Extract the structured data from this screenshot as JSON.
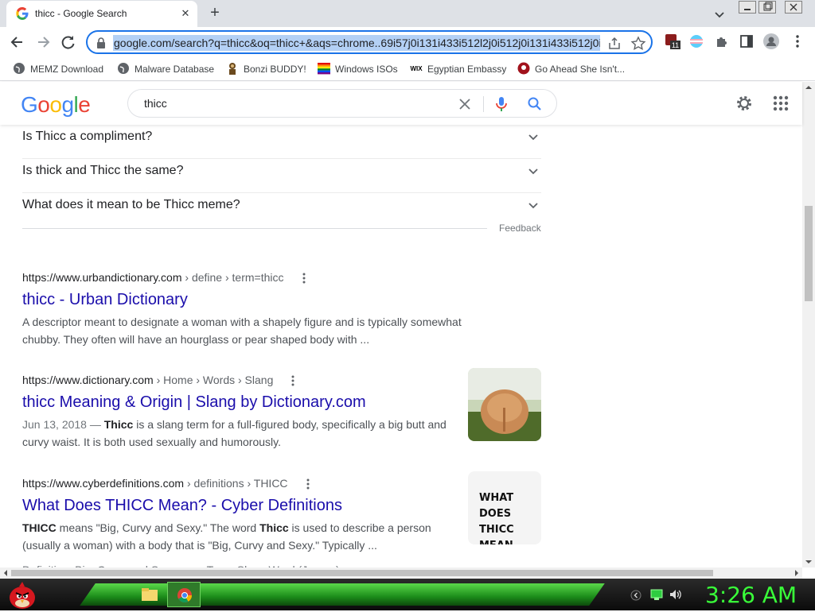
{
  "browser": {
    "tab_title": "thicc - Google Search",
    "url": "google.com/search?q=thicc&oq=thicc+&aqs=chrome..69i57j0i131i433i512l2j0i512j0i131i433i512j0i512",
    "extension_badge": "11",
    "bookmarks": [
      {
        "label": "MEMZ Download",
        "icon": "globe-icon"
      },
      {
        "label": "Malware Database",
        "icon": "globe-icon"
      },
      {
        "label": "Bonzi BUDDY!",
        "icon": "bonzi-icon"
      },
      {
        "label": "Windows ISOs",
        "icon": "rainbow-flag-icon"
      },
      {
        "label": "Egyptian Embassy",
        "icon": "wix-icon"
      },
      {
        "label": "Go Ahead She Isn't...",
        "icon": "red-circle-icon"
      }
    ]
  },
  "google": {
    "logo": "Google",
    "query": "thicc",
    "paa_questions": [
      "Is Thicc a compliment?",
      "Is thick and Thicc the same?",
      "What does it mean to be Thicc meme?"
    ],
    "feedback": "Feedback",
    "results": [
      {
        "domain": "https://www.urbandictionary.com",
        "path": " › define › term=thicc",
        "title": "thicc - Urban Dictionary",
        "snippet": "A descriptor meant to designate a woman with a shapely figure and is typically somewhat chubby. They often will have an hourglass or pear shaped body with ..."
      },
      {
        "domain": "https://www.dictionary.com",
        "path": " › Home › Words › Slang",
        "title": "thicc Meaning & Origin | Slang by Dictionary.com",
        "date": "Jun 13, 2018 — ",
        "snippet_bold": "Thicc",
        "snippet": " is a slang term for a full-figured body, specifically a big butt and curvy waist. It is both used sexually and humorously."
      },
      {
        "domain": "https://www.cyberdefinitions.com",
        "path": " › definitions › THICC",
        "title": "What Does THICC Mean? - Cyber Definitions",
        "snippet_parts": [
          "THICC",
          " means \"Big, Curvy and Sexy.\" The word ",
          "Thicc",
          " is used to describe a person (usually a woman) with a body that is \"Big, Curvy and Sexy.\" Typically ..."
        ],
        "extra_line": "Definition: Big, Curvy and Sexy          Type: Slang Word (Jargon)",
        "thumb_text": "WHAT DOES THICC MEAN"
      }
    ]
  },
  "taskbar": {
    "clock": "3:26 AM"
  },
  "colors": {
    "link": "#1a0dab",
    "accent": "#1a73e8",
    "taskbar_green": "#39ff39"
  }
}
